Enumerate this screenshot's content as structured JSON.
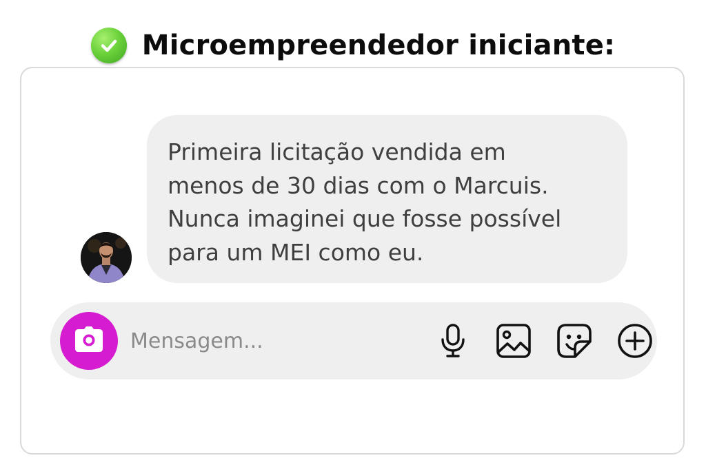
{
  "header": {
    "title": "Microempreendedor iniciante:",
    "icon": "check-circle-icon"
  },
  "message": {
    "text": "Primeira licitação vendida em\nmenos de 30 dias com o Marcuis.\nNunca imaginei que fosse possível\npara um MEI como eu.",
    "avatar_icon": "avatar"
  },
  "composer": {
    "placeholder": "Mensagem...",
    "camera_icon": "camera-icon",
    "icons": [
      "microphone-icon",
      "image-icon",
      "sticker-icon",
      "add-circle-icon"
    ]
  },
  "colors": {
    "accent": "#d61cd0",
    "check": "#5cc431",
    "bubble": "#efefef",
    "border": "#d9d9d9"
  }
}
